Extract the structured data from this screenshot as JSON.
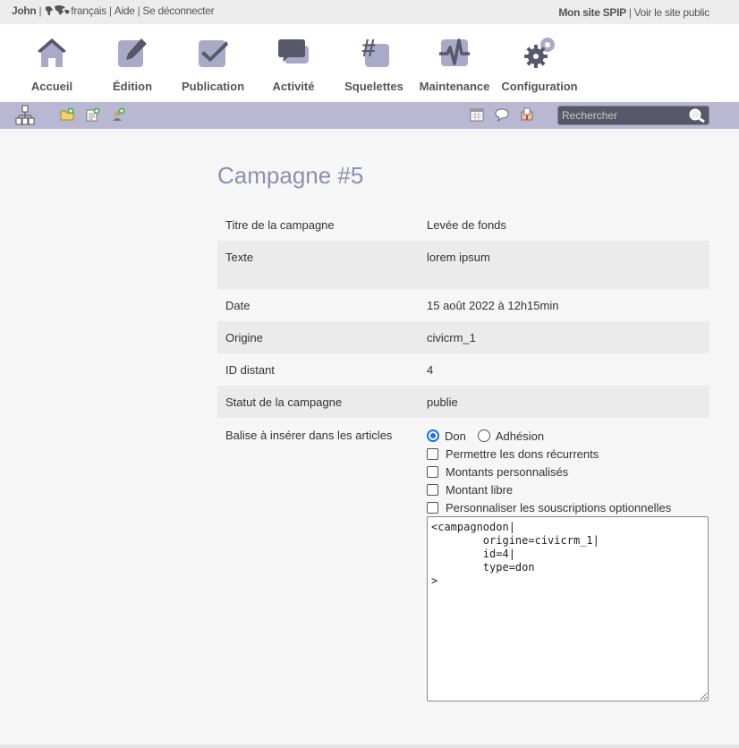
{
  "topbar": {
    "user": "John",
    "language": "français",
    "help": "Aide",
    "logout": "Se déconnecter",
    "site_name": "Mon site SPIP",
    "view_site": "Voir le site public"
  },
  "nav": {
    "items": [
      {
        "label": "Accueil",
        "icon": "home-icon"
      },
      {
        "label": "Édition",
        "icon": "pencil-icon"
      },
      {
        "label": "Publication",
        "icon": "checkmark-icon"
      },
      {
        "label": "Activité",
        "icon": "chat-bubbles-icon"
      },
      {
        "label": "Squelettes",
        "icon": "hash-icon"
      },
      {
        "label": "Maintenance",
        "icon": "pulse-icon"
      },
      {
        "label": "Configuration",
        "icon": "gears-icon"
      }
    ]
  },
  "toolbar": {
    "left_icons": [
      "site-map-icon",
      "new-folder-icon",
      "new-article-icon",
      "new-author-icon"
    ],
    "right_icons": [
      "calendar-icon",
      "messages-icon",
      "mailbox-icon"
    ],
    "search": {
      "placeholder": "Rechercher"
    }
  },
  "page": {
    "title": "Campagne #5",
    "fields": [
      {
        "label": "Titre de la campagne",
        "value": "Levée de fonds"
      },
      {
        "label": "Texte",
        "value": "lorem ipsum"
      },
      {
        "label": "Date",
        "value": "15 août 2022 à 12h15min"
      },
      {
        "label": "Origine",
        "value": "civicrm_1"
      },
      {
        "label": "ID distant",
        "value": "4"
      },
      {
        "label": "Statut de la campagne",
        "value": "publie"
      }
    ],
    "balise": {
      "label": "Balise à insérer dans les articles",
      "radio_don": "Don",
      "radio_adhesion": "Adhésion",
      "selected": "Don",
      "checkboxes": [
        "Permettre les dons récurrents",
        "Montants personnalisés",
        "Montant libre",
        "Personnaliser les souscriptions optionnelles"
      ],
      "code": "<campagnodon|\n\torigine=civicrm_1|\n\tid=4|\n\ttype=don\n>"
    }
  },
  "colors": {
    "accent": "#8e8eb7",
    "toolbar": "#b8b8d2",
    "icon": "#a9a9c8",
    "radio": "#1a73e8"
  }
}
